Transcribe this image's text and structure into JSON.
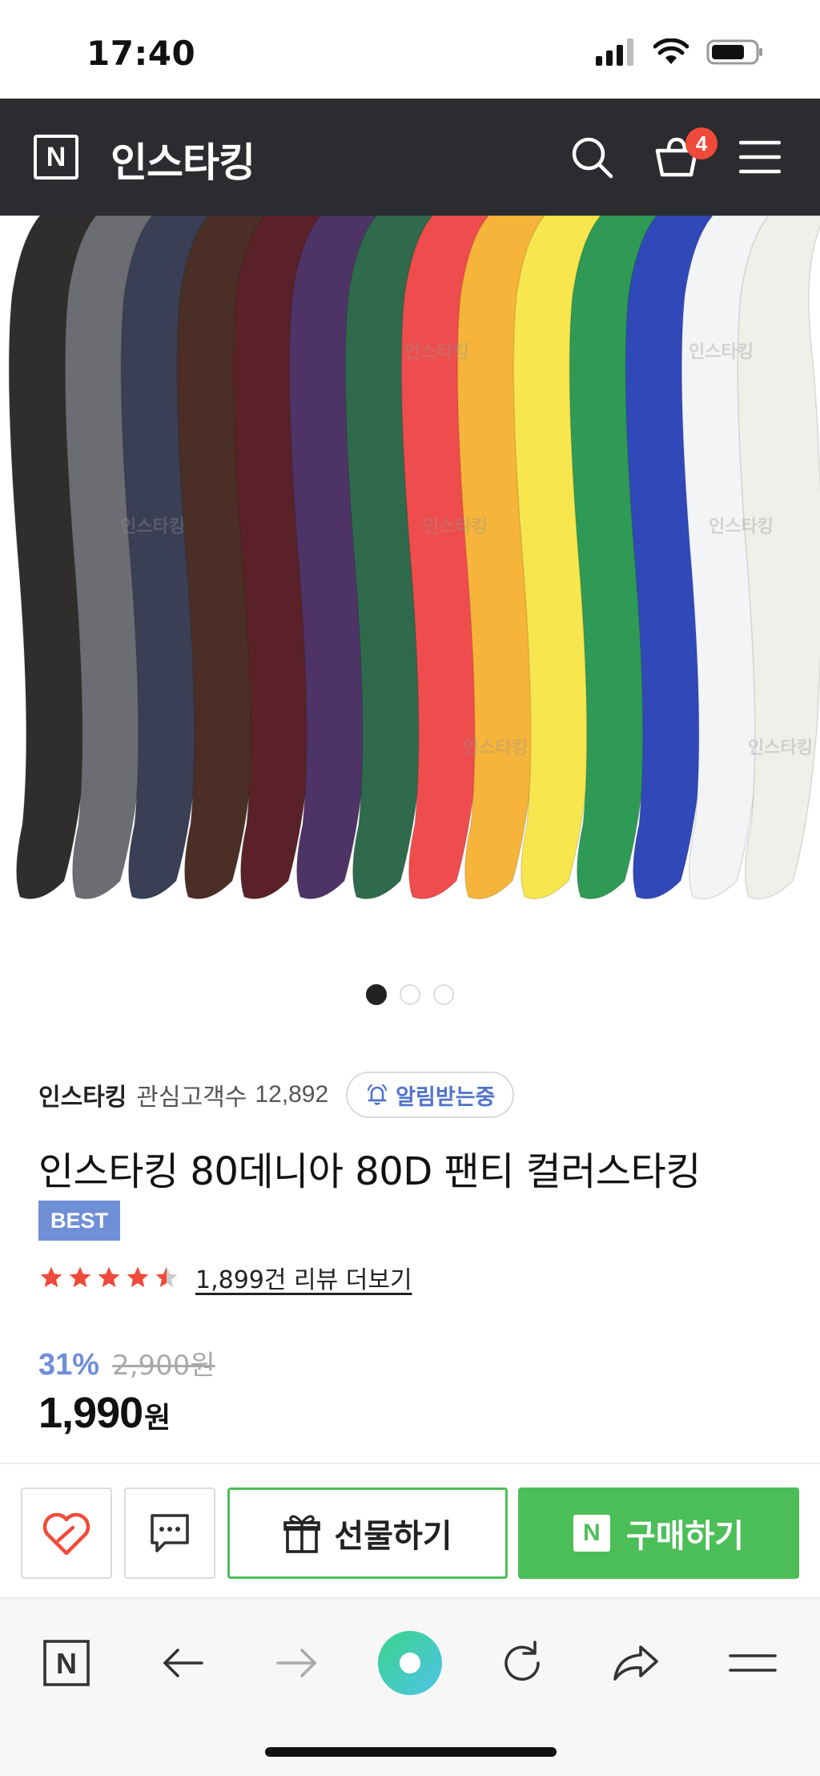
{
  "status": {
    "time": "17:40"
  },
  "header": {
    "logo_letter": "N",
    "title": "인스타킹",
    "cart_count": "4"
  },
  "product": {
    "image_watermark": "인스타킹",
    "image_colors": [
      "#2f2e2c",
      "#6c6d72",
      "#3a3f55",
      "#4b2f26",
      "#5a2228",
      "#4e3466",
      "#2f6a4c",
      "#ef4d4d",
      "#f6b43a",
      "#f7e64e",
      "#2f9a55",
      "#3148b8",
      "#f2f4f5",
      "#eef0ea"
    ],
    "pager": {
      "total": 3,
      "active": 0
    },
    "seller": "인스타킹",
    "fans_label": "관심고객수",
    "fans_count": "12,892",
    "notify_label": "알림받는중",
    "title": "인스타킹 80데니아 80D 팬티 컬러스타킹",
    "badge": "BEST",
    "rating": 4.5,
    "review_link": "1,899건 리뷰 더보기",
    "discount": "31%",
    "original_price": "2,900원",
    "price": "1,990",
    "price_unit": "원"
  },
  "actions": {
    "gift_label": "선물하기",
    "buy_label": "구매하기",
    "buy_logo": "N"
  },
  "browser": {
    "logo_letter": "N"
  },
  "colors": {
    "accent_blue": "#6f8fd6",
    "naver_green": "#4cbe58",
    "header_bg": "#2b2c2f",
    "star_red": "#f04a3a"
  }
}
